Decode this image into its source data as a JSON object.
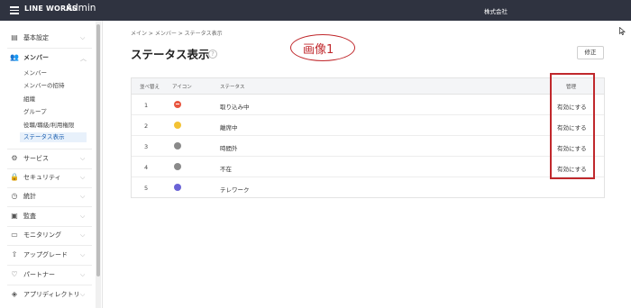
{
  "topbar": {
    "brand": "LINE WORKS",
    "product": "Admin",
    "company": "株式会社"
  },
  "sidebar": {
    "sections": [
      {
        "icon": "building-icon",
        "label": "基本設定"
      },
      {
        "icon": "users-icon",
        "label": "メンバー"
      },
      {
        "icon": "gear-icon",
        "label": "サービス"
      },
      {
        "icon": "lock-icon",
        "label": "セキュリティ"
      },
      {
        "icon": "clock-icon",
        "label": "統計"
      },
      {
        "icon": "audit-icon",
        "label": "監査"
      },
      {
        "icon": "monitor-icon",
        "label": "モニタリング"
      },
      {
        "icon": "upgrade-icon",
        "label": "アップグレード"
      },
      {
        "icon": "handshake-icon",
        "label": "パートナー"
      },
      {
        "icon": "layers-icon",
        "label": "アプリディレクトリ"
      }
    ],
    "member_items": [
      {
        "label": "メンバー"
      },
      {
        "label": "メンバーの招待"
      },
      {
        "label": "組織"
      },
      {
        "label": "グループ"
      },
      {
        "label": "役職/職級/利用権限"
      },
      {
        "label": "ステータス表示"
      }
    ]
  },
  "breadcrumb": "メイン > メンバー > ステータス表示",
  "page_title": "ステータス表示",
  "edit_label": "修正",
  "annotation_label": "画像1",
  "table": {
    "headers": {
      "order": "並べ替え",
      "icon": "アイコン",
      "status": "ステータス",
      "manage": "管理"
    },
    "rows": [
      {
        "order": "1",
        "icon_color": "#e8553f",
        "icon_name": "minus-circle-icon",
        "status": "取り込み中",
        "action": "有効にする"
      },
      {
        "order": "2",
        "icon_color": "#f3c234",
        "icon_name": "clock-circle-icon",
        "status": "離席中",
        "action": "有効にする"
      },
      {
        "order": "3",
        "icon_color": "#8a8a8a",
        "icon_name": "moon-circle-icon",
        "status": "時間外",
        "action": "有効にする"
      },
      {
        "order": "4",
        "icon_color": "#8a8a8a",
        "icon_name": "absent-circle-icon",
        "status": "不在",
        "action": "有効にする"
      },
      {
        "order": "5",
        "icon_color": "#6a63d6",
        "icon_name": "telework-circle-icon",
        "status": "テレワーク",
        "action": ""
      }
    ]
  },
  "colors": {
    "topbar": "#2f3340",
    "annotation": "#c0282c",
    "active_item": "#1b5fb0"
  }
}
